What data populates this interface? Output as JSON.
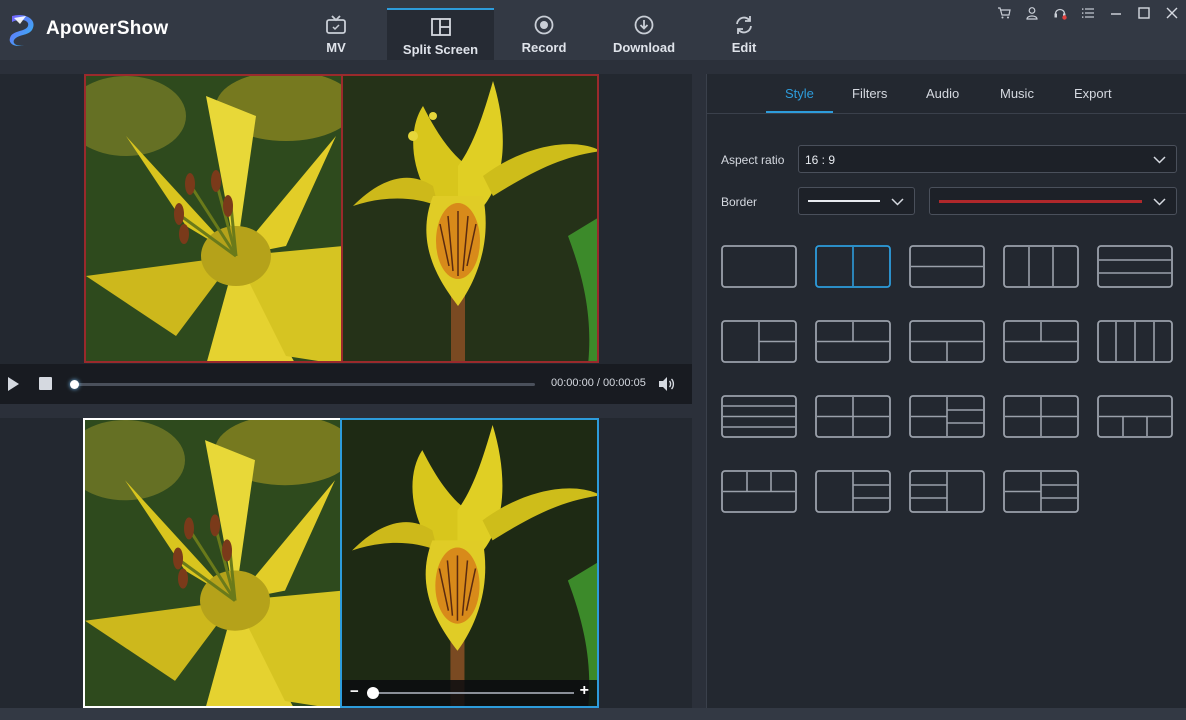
{
  "app": {
    "name": "ApowerShow"
  },
  "nav": [
    {
      "label": "MV",
      "icon": "tv-icon"
    },
    {
      "label": "Split Screen",
      "icon": "split-screen-icon"
    },
    {
      "label": "Record",
      "icon": "record-icon"
    },
    {
      "label": "Download",
      "icon": "download-icon"
    },
    {
      "label": "Edit",
      "icon": "refresh-icon"
    }
  ],
  "active_nav": "Split Screen",
  "window_controls": [
    "cart-icon",
    "user-icon",
    "support-icon",
    "menu-icon",
    "minimize-icon",
    "maximize-icon",
    "close-icon"
  ],
  "player": {
    "time": "00:00:00 / 00:00:05",
    "progress": 0
  },
  "edit": {
    "zoom_level": 0
  },
  "right_panel": {
    "tabs": [
      "Style",
      "Filters",
      "Audio",
      "Music",
      "Export"
    ],
    "active_tab": "Style",
    "aspect_ratio_label": "Aspect ratio",
    "aspect_ratio_value": "16 : 9",
    "border_label": "Border",
    "border_color": "#b0282b"
  },
  "layouts": {
    "count": 19,
    "selected_index": 1
  },
  "colors": {
    "accent": "#2d9cdb",
    "border_red": "#9a2a2c",
    "bg": "#232830",
    "topbar": "#333944"
  }
}
